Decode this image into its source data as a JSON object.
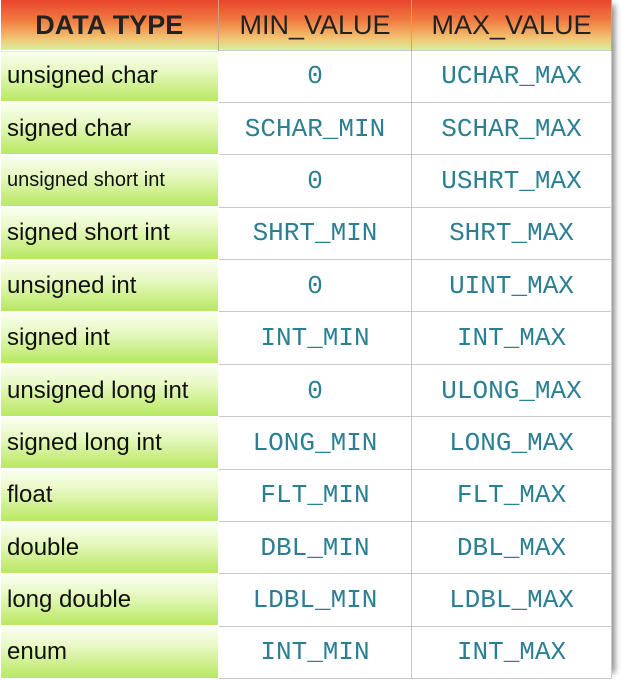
{
  "headers": [
    "DATA TYPE",
    "MIN_VALUE",
    "MAX_VALUE"
  ],
  "rows": [
    {
      "type": "unsigned char",
      "min": "0",
      "max": "UCHAR_MAX"
    },
    {
      "type": "signed char",
      "min": "SCHAR_MIN",
      "max": "SCHAR_MAX"
    },
    {
      "type": "unsigned short int",
      "min": "0",
      "max": "USHRT_MAX"
    },
    {
      "type": "signed short int",
      "min": "SHRT_MIN",
      "max": "SHRT_MAX"
    },
    {
      "type": "unsigned int",
      "min": "0",
      "max": "UINT_MAX"
    },
    {
      "type": "signed int",
      "min": "INT_MIN",
      "max": "INT_MAX"
    },
    {
      "type": "unsigned long int",
      "min": "0",
      "max": "ULONG_MAX"
    },
    {
      "type": "signed long int",
      "min": "LONG_MIN",
      "max": "LONG_MAX"
    },
    {
      "type": "float",
      "min": "FLT_MIN",
      "max": "FLT_MAX"
    },
    {
      "type": "double",
      "min": "DBL_MIN",
      "max": "DBL_MAX"
    },
    {
      "type": "long double",
      "min": "LDBL_MIN",
      "max": "LDBL_MAX"
    },
    {
      "type": "enum",
      "min": "INT_MIN",
      "max": "INT_MAX"
    }
  ],
  "colors": {
    "header_top": "#e8452c",
    "type_cell": "#b8e860",
    "value_text": "#2b7f92"
  }
}
